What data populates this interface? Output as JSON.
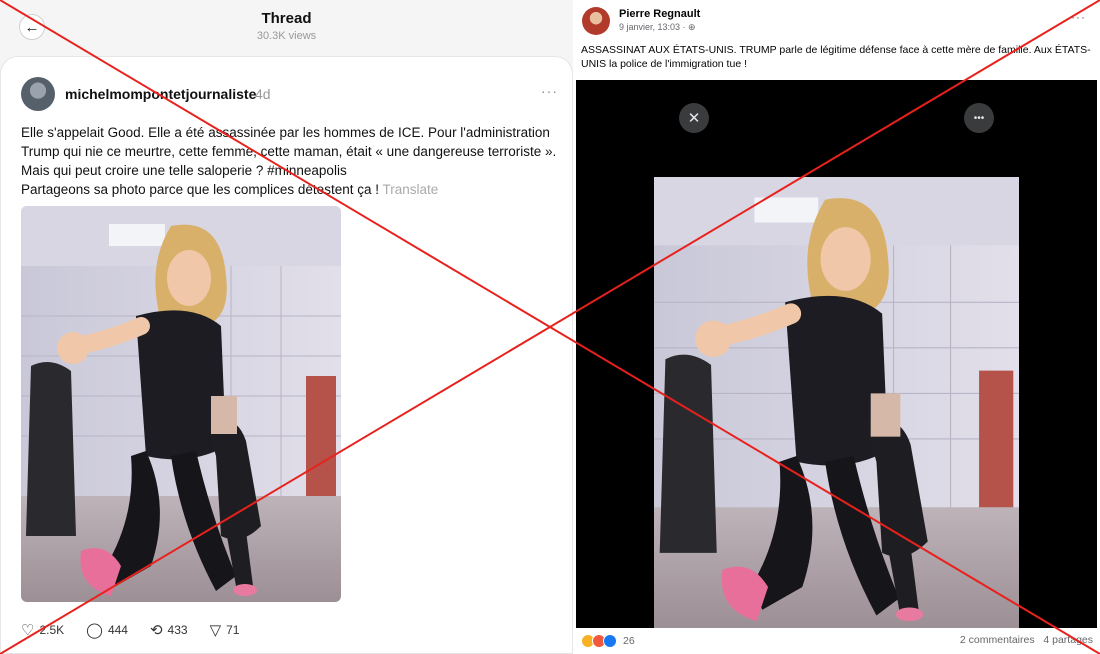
{
  "threads": {
    "header": {
      "title": "Thread",
      "views": "30.3K views"
    },
    "post": {
      "author": "michelmompontetjournaliste",
      "age": "4d",
      "lines": [
        "Elle s'appelait Good. Elle a été assassinée par les hommes de ICE. Pour l'administration",
        "Trump qui nie ce meurtre, cette femme, cette maman, était « une dangereuse terroriste ».",
        "Mais qui peut croire une telle saloperie ? #minneapolis",
        "Partageons sa photo parce que les complices détestent ça !"
      ],
      "translate": "Translate",
      "likes": "2.5K",
      "comments": "444",
      "reposts": "433",
      "shares": "71"
    }
  },
  "facebook": {
    "author": "Pierre Regnault",
    "date": "9 janvier, 13:03 · ",
    "text": "ASSASSINAT AUX ÉTATS-UNIS. TRUMP parle de légitime défense face à cette mère de famille. Aux ÉTATS-UNIS la police de l'immigration tue !",
    "reaction_count": "26",
    "comments": "2 commentaires",
    "shares": "4 partages",
    "reaction_colors": [
      "#f7b125",
      "#f0593c",
      "#1877f2"
    ]
  },
  "overlay": {
    "cross_color": "#e8211c"
  }
}
